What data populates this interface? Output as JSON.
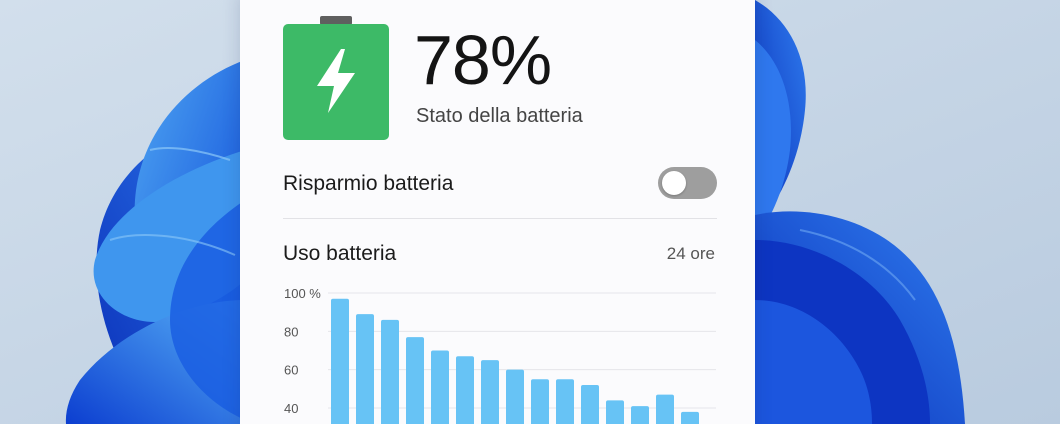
{
  "battery": {
    "percent_text": "78%",
    "level": 0.78,
    "status_label": "Stato della batteria",
    "icon": "battery-charging-icon",
    "color": "#3dba67"
  },
  "battery_saver": {
    "label": "Risparmio batteria",
    "enabled": false
  },
  "usage": {
    "title": "Uso batteria",
    "range": "24 ore"
  },
  "chart_data": {
    "type": "bar",
    "values": [
      97,
      89,
      86,
      77,
      70,
      67,
      65,
      60,
      55,
      55,
      52,
      44,
      41,
      47,
      38
    ],
    "y_ticks": [
      "100 %",
      "80",
      "60",
      "40"
    ],
    "ylim": [
      0,
      100
    ],
    "grid": true,
    "bar_color": "#67c3f5"
  },
  "colors": {
    "accent_green": "#3dba67",
    "bar_blue": "#67c3f5"
  }
}
